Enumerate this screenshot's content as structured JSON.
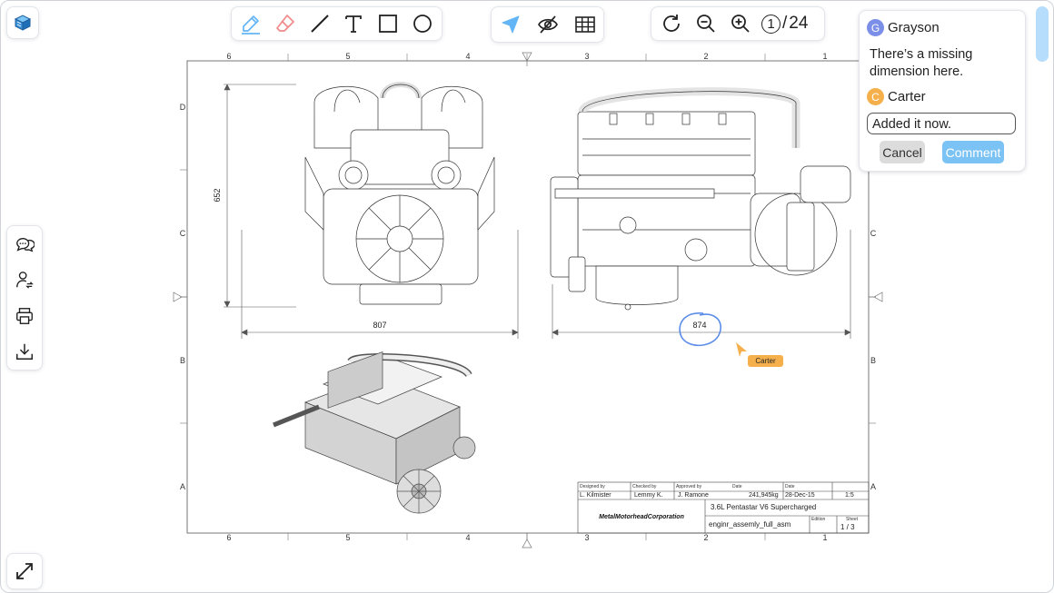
{
  "toolbar_draw": {
    "tools": [
      "pen-icon",
      "eraser-icon",
      "line-icon",
      "text-icon",
      "rectangle-icon",
      "circle-icon"
    ]
  },
  "toolbar_view": {
    "tools": [
      "pointer-icon",
      "hide-icon",
      "grid-icon"
    ]
  },
  "toolbar_nav": {
    "current_page": "1",
    "separator": "/",
    "total_pages": "24"
  },
  "sidebar": {
    "items": [
      "comments-icon",
      "user-switch-icon",
      "print-icon",
      "download-icon"
    ]
  },
  "drawing": {
    "column_labels": [
      "6",
      "5",
      "4",
      "3",
      "2",
      "1"
    ],
    "row_labels": [
      "D",
      "C",
      "B",
      "A"
    ],
    "dim_height": "652",
    "dim_width_front": "807",
    "dim_width_side": "874",
    "title_block": {
      "designed_by_label": "Designed by",
      "designed_by": "L. Kilmister",
      "checked_by_label": "Checked by",
      "checked_by": "Lemmy K.",
      "approved_by_label": "Approved by",
      "approved_by": "J. Ramone",
      "date_label": "Date",
      "date2_label": "Date",
      "mass": "241,945kg",
      "date": "28-Dec-15",
      "scale": "1:5",
      "company": "MetalMotorheadCorporation",
      "title": "3.6L Pentastar V6 Supercharged",
      "file": "enginr_assemly_full_asm",
      "edition_label": "Edition",
      "sheet_label": "Sheet",
      "sheet": "1 / 3"
    }
  },
  "cursor_tag": "Carter",
  "comments": {
    "first_author": "Grayson",
    "first_initial": "G",
    "first_text": "There’s a missing dimension here.",
    "second_author": "Carter",
    "second_initial": "C",
    "input_value": "Added it now.",
    "cancel_label": "Cancel",
    "submit_label": "Comment"
  },
  "colors": {
    "accent": "#64b5f6",
    "grayson": "#7b8ee8",
    "carter": "#f5b04c",
    "annotation": "#5b8de8"
  }
}
